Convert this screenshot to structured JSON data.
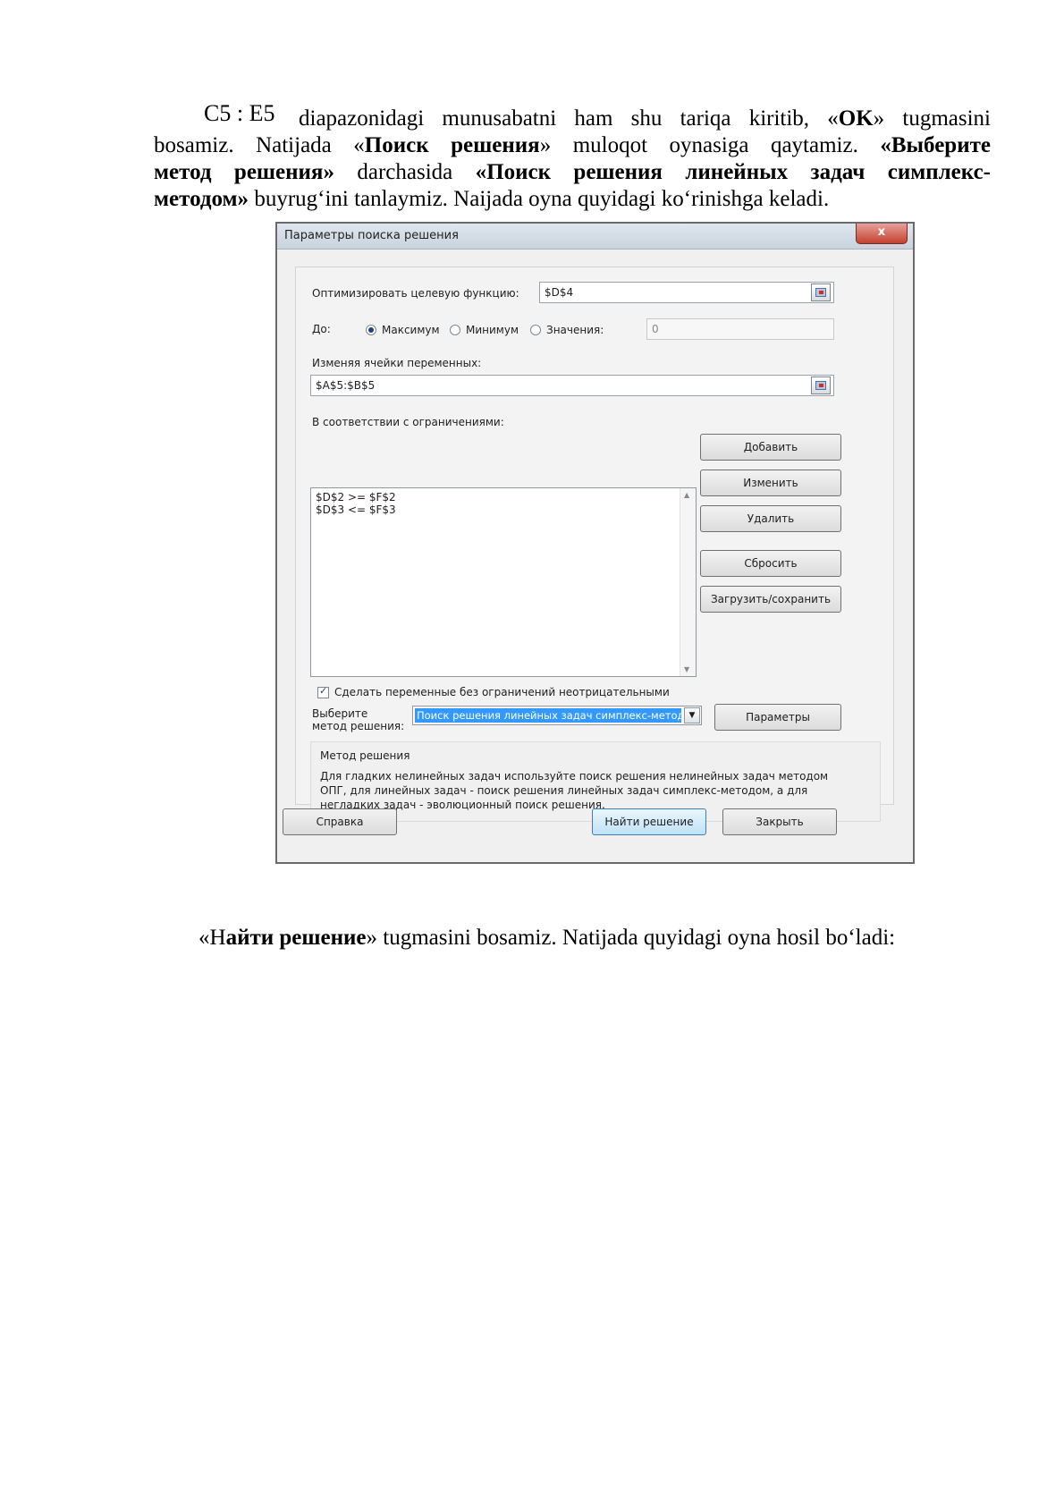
{
  "paragraph1": {
    "formula": "C5 : E5",
    "line1": {
      "text": "diapazonidagi munusabatni ham shu tariqa kiritib, «",
      "bold1": "OK",
      "tail": "» tugmasini"
    },
    "line2": {
      "pre": "bosamiz.  Natijada «",
      "bold1": "Поиск решения",
      "mid": "» muloqot oynasiga qaytamiz. ",
      "bold2": "«Выберите"
    },
    "line3": {
      "bold1": "метод  решения»",
      "mid": " darchasida ",
      "bold2": "«Поиск  решения  линейных  задач  симплекс-"
    },
    "line4": {
      "bold1": "методом»",
      "tail": "  buyrug‘ini tanlaymiz. Naijada oyna quyidagi ko‘rinishga keladi."
    }
  },
  "dialog": {
    "title": "Параметры поиска решения",
    "close_label": "x",
    "objective_label": "Оптимизировать целевую функцию:",
    "objective_value": "$D$4",
    "to_label": "До:",
    "radio_max": "Максимум",
    "radio_min": "Минимум",
    "radio_value": "Значения:",
    "value_field": "0",
    "changing_label": "Изменяя ячейки переменных:",
    "changing_value": "$A$5:$B$5",
    "constraints_label": "В соответствии с ограничениями:",
    "constraints": [
      "$D$2 >= $F$2",
      "$D$3 <= $F$3"
    ],
    "btn_add": "Добавить",
    "btn_change": "Изменить",
    "btn_delete": "Удалить",
    "btn_reset": "Сбросить",
    "btn_load_save": "Загрузить/сохранить",
    "nonneg_label": "Сделать переменные без ограничений неотрицательными",
    "method_label_1": "Выберите",
    "method_label_2": "метод решения:",
    "method_value": "Поиск решения линейных задач симплекс-методом",
    "btn_params": "Параметры",
    "group_title": "Метод решения",
    "group_desc": "Для гладких нелинейных задач используйте поиск решения нелинейных задач методом ОПГ, для линейных задач - поиск решения линейных задач симплекс-методом, а для негладких задач - эволюционный поиск решения.",
    "btn_help": "Справка",
    "btn_solve": "Найти решение",
    "btn_close": "Закрыть"
  },
  "paragraph2": {
    "pre": "«Н",
    "bold": "айти решение",
    "tail": "» tugmasini bosamiz. Natijada quyidagi oyna hosil bo‘ladi:"
  }
}
